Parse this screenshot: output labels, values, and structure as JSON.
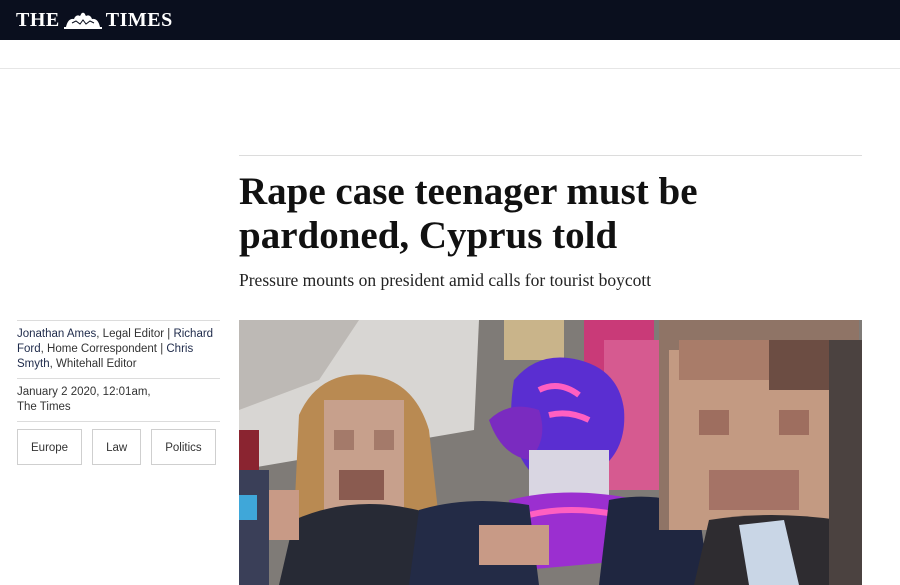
{
  "masthead": {
    "logo_left": "THE",
    "logo_right": "TIMES",
    "crest_icon": "royal-crest-icon",
    "background": "#0a0f1e"
  },
  "article": {
    "headline": "Rape case teenager must be pardoned, Cyprus told",
    "standfirst": "Pressure mounts on president amid calls for tourist boycott"
  },
  "byline": {
    "author1": "Jonathan Ames",
    "role1": ", Legal Editor | ",
    "author2": "Richard Ford",
    "role2": ", Home Correspondent | ",
    "author3": "Chris Smyth",
    "role3": ", Whitehall Editor"
  },
  "dateline": {
    "date": "January 2 2020, 12:01am,",
    "source": "The Times"
  },
  "tags": [
    "Europe",
    "Law",
    "Politics"
  ],
  "photo": {
    "description_colors": {
      "scarf": "#5b2dbf",
      "face_blur": "#c49a86",
      "sky": "#d9d7d4"
    }
  }
}
